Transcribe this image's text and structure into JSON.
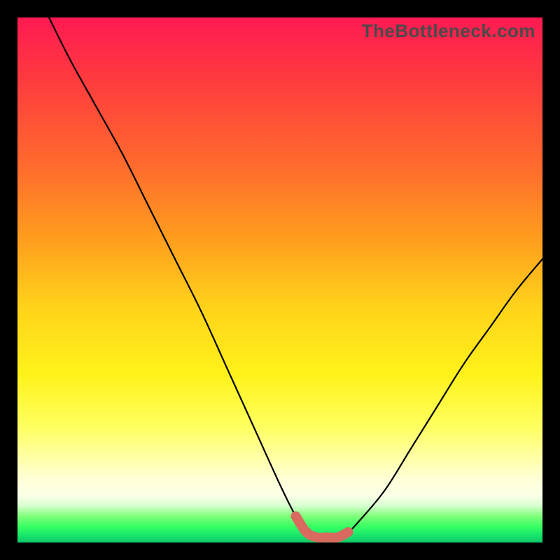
{
  "watermark": "TheBottleneck.com",
  "colors": {
    "frame": "#000000",
    "curve": "#000000",
    "highlight": "#d86a60",
    "gradient_stops": [
      "#ff1a52",
      "#ff3b3e",
      "#ff6a2d",
      "#ff9d1e",
      "#ffd21a",
      "#fff21a",
      "#ffff60",
      "#ffffa8",
      "#ffffd8",
      "#fbffe6",
      "#d7ffd0",
      "#7fff7a",
      "#36ff62",
      "#18e86a",
      "#10c96a"
    ]
  },
  "chart_data": {
    "type": "line",
    "title": "",
    "xlabel": "",
    "ylabel": "",
    "xlim": [
      0,
      100
    ],
    "ylim": [
      0,
      100
    ],
    "x": [
      6,
      10,
      15,
      20,
      25,
      30,
      35,
      40,
      45,
      50,
      53,
      55,
      57,
      59,
      61,
      63,
      65,
      70,
      75,
      80,
      85,
      90,
      95,
      100
    ],
    "values": [
      100,
      92,
      83,
      74,
      64,
      54,
      44,
      33,
      22,
      11,
      5,
      2,
      1,
      1,
      1,
      2,
      4,
      10,
      18,
      26,
      34,
      41,
      48,
      54
    ],
    "highlight_region": {
      "x_start": 53,
      "x_end": 64,
      "y_approx": 2
    },
    "notes": "Values estimated from pixel positions; y=0 is bottom, y=100 is top. Curve descends steeply from upper-left, bottoms out near x≈55-62 (highlighted segment in salmon), then rises toward the right at a shallower slope. No axes, ticks, or numeric labels are rendered."
  }
}
